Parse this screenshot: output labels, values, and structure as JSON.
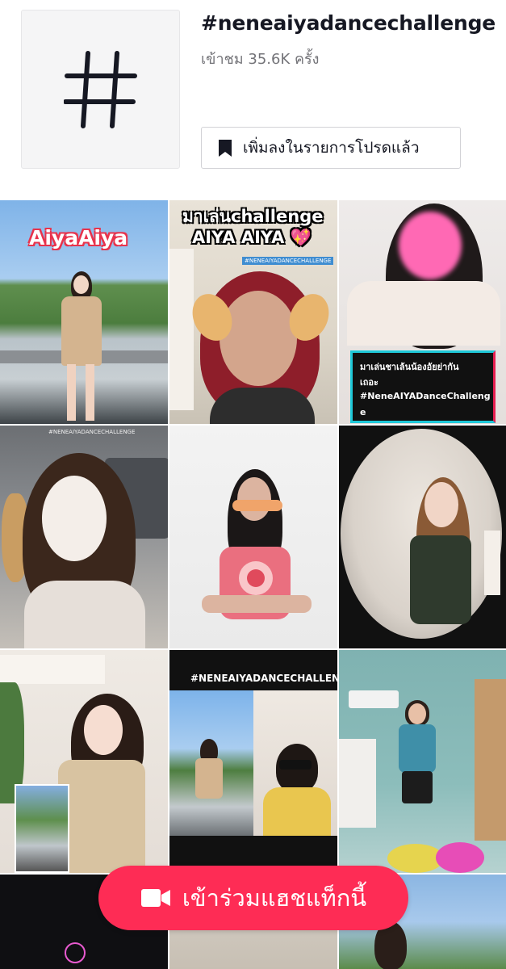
{
  "hashtag": {
    "title": "#neneaiyadancechallenge",
    "views": "เข้าชม 35.6K ครั้ง",
    "favorite_button_label": "เพิ่มลงในรายการโปรดแล้ว",
    "icon": "hashtag-icon"
  },
  "videos": [
    {
      "overlay": "AiyaAiya",
      "scene": "outdoor-dance"
    },
    {
      "overlay_line1": "มาเล่นchallenge",
      "overlay_line2": "AIYA AIYA 💖",
      "tag": "#NENEAIYADANCECHALLENGE",
      "scene": "bunny-filter"
    },
    {
      "caption_line1": "มาเล่นชาเล้นน้องอัยย่ากัน",
      "caption_line2": "เถอะ",
      "caption_line3": "#NeneAIYADanceChalleng",
      "caption_line4": "e",
      "scene": "blurred-face"
    },
    {
      "tag": "#NENEAIYADANCECHALLENGE",
      "scene": "face-mask-filter"
    },
    {
      "scene": "heart-top"
    },
    {
      "scene": "fisheye-room"
    },
    {
      "scene": "room-duet"
    },
    {
      "banner": "#NENEAIYADANCECHALLENGE",
      "scene": "split-duet"
    },
    {
      "scene": "teal-room"
    },
    {
      "scene": "dark-neon"
    },
    {
      "scene": "partial"
    },
    {
      "scene": "partial-sky"
    }
  ],
  "join_button": {
    "label": "เข้าร่วมแฮชแท็กนี้",
    "icon": "video-camera-icon"
  },
  "colors": {
    "accent": "#fe2c55",
    "text_primary": "#161823",
    "text_secondary": "#737378"
  }
}
